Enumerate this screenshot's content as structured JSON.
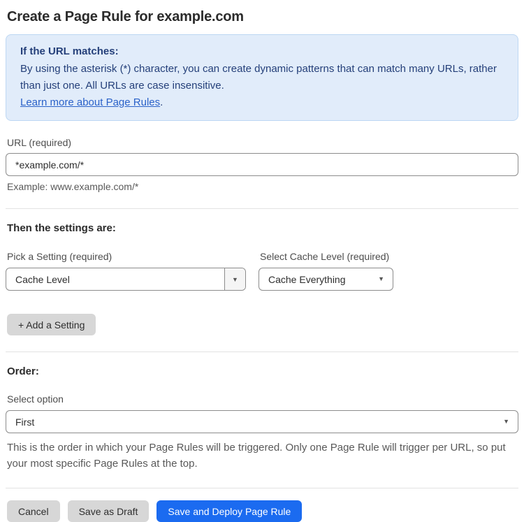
{
  "page": {
    "title": "Create a Page Rule for example.com"
  },
  "info_box": {
    "heading": "If the URL matches:",
    "body": "By using the asterisk (*) character, you can create dynamic patterns that can match many URLs, rather than just one. All URLs are case insensitive.",
    "link_label": "Learn more about Page Rules",
    "link_suffix": "."
  },
  "url_field": {
    "label": "URL (required)",
    "value": "*example.com/*",
    "hint": "Example: www.example.com/*"
  },
  "settings_section": {
    "heading": "Then the settings are:",
    "setting_label": "Pick a Setting (required)",
    "setting_value": "Cache Level",
    "cache_level_label": "Select Cache Level (required)",
    "cache_level_value": "Cache Everything",
    "add_setting_label": "+ Add a Setting"
  },
  "order_section": {
    "heading": "Order:",
    "select_label": "Select option",
    "select_value": "First",
    "help_text": "This is the order in which your Page Rules will be triggered. Only one Page Rule will trigger per URL, so put your most specific Page Rules at the top."
  },
  "footer": {
    "cancel_label": "Cancel",
    "save_draft_label": "Save as Draft",
    "save_deploy_label": "Save and Deploy Page Rule"
  },
  "icons": {
    "dropdown_arrow": "▼"
  },
  "colors": {
    "accent_blue": "#1b6bf0",
    "info_box_bg": "#e1ecfa",
    "info_box_border": "#bdd7f3",
    "info_text": "#25407a",
    "link_blue": "#2b62c9",
    "gray_button_bg": "#d7d7d7",
    "input_border": "#8c8c8c",
    "divider": "#e3e3e3"
  }
}
